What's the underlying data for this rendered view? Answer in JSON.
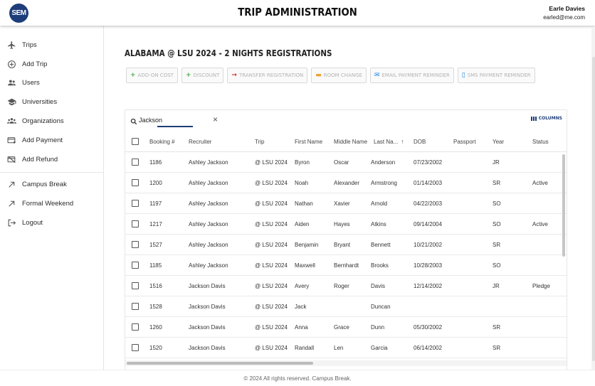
{
  "header": {
    "logo_text": "SEM",
    "title": "TRIP ADMINISTRATION",
    "user_name": "Earle Davies",
    "user_email": "earled@me.com"
  },
  "sidebar": {
    "items": [
      {
        "label": "Trips",
        "icon": "plane-icon"
      },
      {
        "label": "Add Trip",
        "icon": "add-circle-icon"
      },
      {
        "label": "Users",
        "icon": "users-icon"
      },
      {
        "label": "Universities",
        "icon": "graduation-cap-icon"
      },
      {
        "label": "Organizations",
        "icon": "organizations-icon"
      },
      {
        "label": "Add Payment",
        "icon": "payment-icon"
      },
      {
        "label": "Add Refund",
        "icon": "refund-icon"
      }
    ],
    "links": [
      {
        "label": "Campus Break",
        "icon": "external-arrow-icon"
      },
      {
        "label": "Formal Weekend",
        "icon": "external-arrow-icon"
      },
      {
        "label": "Logout",
        "icon": "logout-icon"
      }
    ]
  },
  "page": {
    "title": "ALABAMA @ LSU 2024 - 2 NIGHTS REGISTRATIONS"
  },
  "actions": [
    {
      "label": "ADD-ON COST",
      "icon": "+",
      "color": "#4caf50"
    },
    {
      "label": "DISCOUNT",
      "icon": "+",
      "color": "#4caf50"
    },
    {
      "label": "TRANSFER REGISTRATION",
      "icon": "→",
      "color": "#d32f2f"
    },
    {
      "label": "ROOM CHANGE",
      "icon": "▬",
      "color": "#f0a030"
    },
    {
      "label": "EMAIL PAYMENT REMINDER",
      "icon": "✉",
      "color": "#1e88e5"
    },
    {
      "label": "SMS PAYMENT REMINDER",
      "icon": "▯",
      "color": "#1e88e5"
    }
  ],
  "table": {
    "search_value": "Jackson",
    "columns_label": "COLUMNS",
    "headers": [
      "Booking #",
      "Recruiter",
      "Trip",
      "First Name",
      "Middle Name",
      "Last Na...",
      "DOB",
      "Passport",
      "Year",
      "Status"
    ],
    "rows": [
      [
        "1186",
        "Ashley Jackson",
        "@ LSU 2024",
        "Byron",
        "Oscar",
        "Anderson",
        "07/23/2002",
        "",
        "JR",
        ""
      ],
      [
        "1200",
        "Ashley Jackson",
        "@ LSU 2024",
        "Noah",
        "Alexander",
        "Armstrong",
        "01/14/2003",
        "",
        "SR",
        "Active"
      ],
      [
        "1197",
        "Ashley Jackson",
        "@ LSU 2024",
        "Nathan",
        "Xavier",
        "Arnold",
        "04/22/2003",
        "",
        "SO",
        ""
      ],
      [
        "1217",
        "Ashley Jackson",
        "@ LSU 2024",
        "Aiden",
        "Hayes",
        "Atkins",
        "09/14/2004",
        "",
        "SO",
        "Active"
      ],
      [
        "1527",
        "Ashley Jackson",
        "@ LSU 2024",
        "Benjamin",
        "Bryant",
        "Bennett",
        "10/21/2002",
        "",
        "SR",
        ""
      ],
      [
        "1185",
        "Ashley Jackson",
        "@ LSU 2024",
        "Maxwell",
        "Bernhardt",
        "Brooks",
        "10/28/2003",
        "",
        "SO",
        ""
      ],
      [
        "1516",
        "Jackson Davis",
        "@ LSU 2024",
        "Avery",
        "Roger",
        "Davis",
        "12/14/2002",
        "",
        "JR",
        "Pledge"
      ],
      [
        "1528",
        "Jackson Davis",
        "@ LSU 2024",
        "Jack",
        "",
        "Duncan",
        "",
        "",
        "",
        ""
      ],
      [
        "1260",
        "Jackson Davis",
        "@ LSU 2024",
        "Anna",
        "Grace",
        "Dunn",
        "05/30/2002",
        "",
        "SR",
        ""
      ],
      [
        "1520",
        "Jackson Davis",
        "@ LSU 2024",
        "Randall",
        "Len",
        "Garcia",
        "06/14/2002",
        "",
        "SR",
        ""
      ]
    ]
  },
  "footer": {
    "text": "© 2024 All rights reserved. Campus Break."
  }
}
